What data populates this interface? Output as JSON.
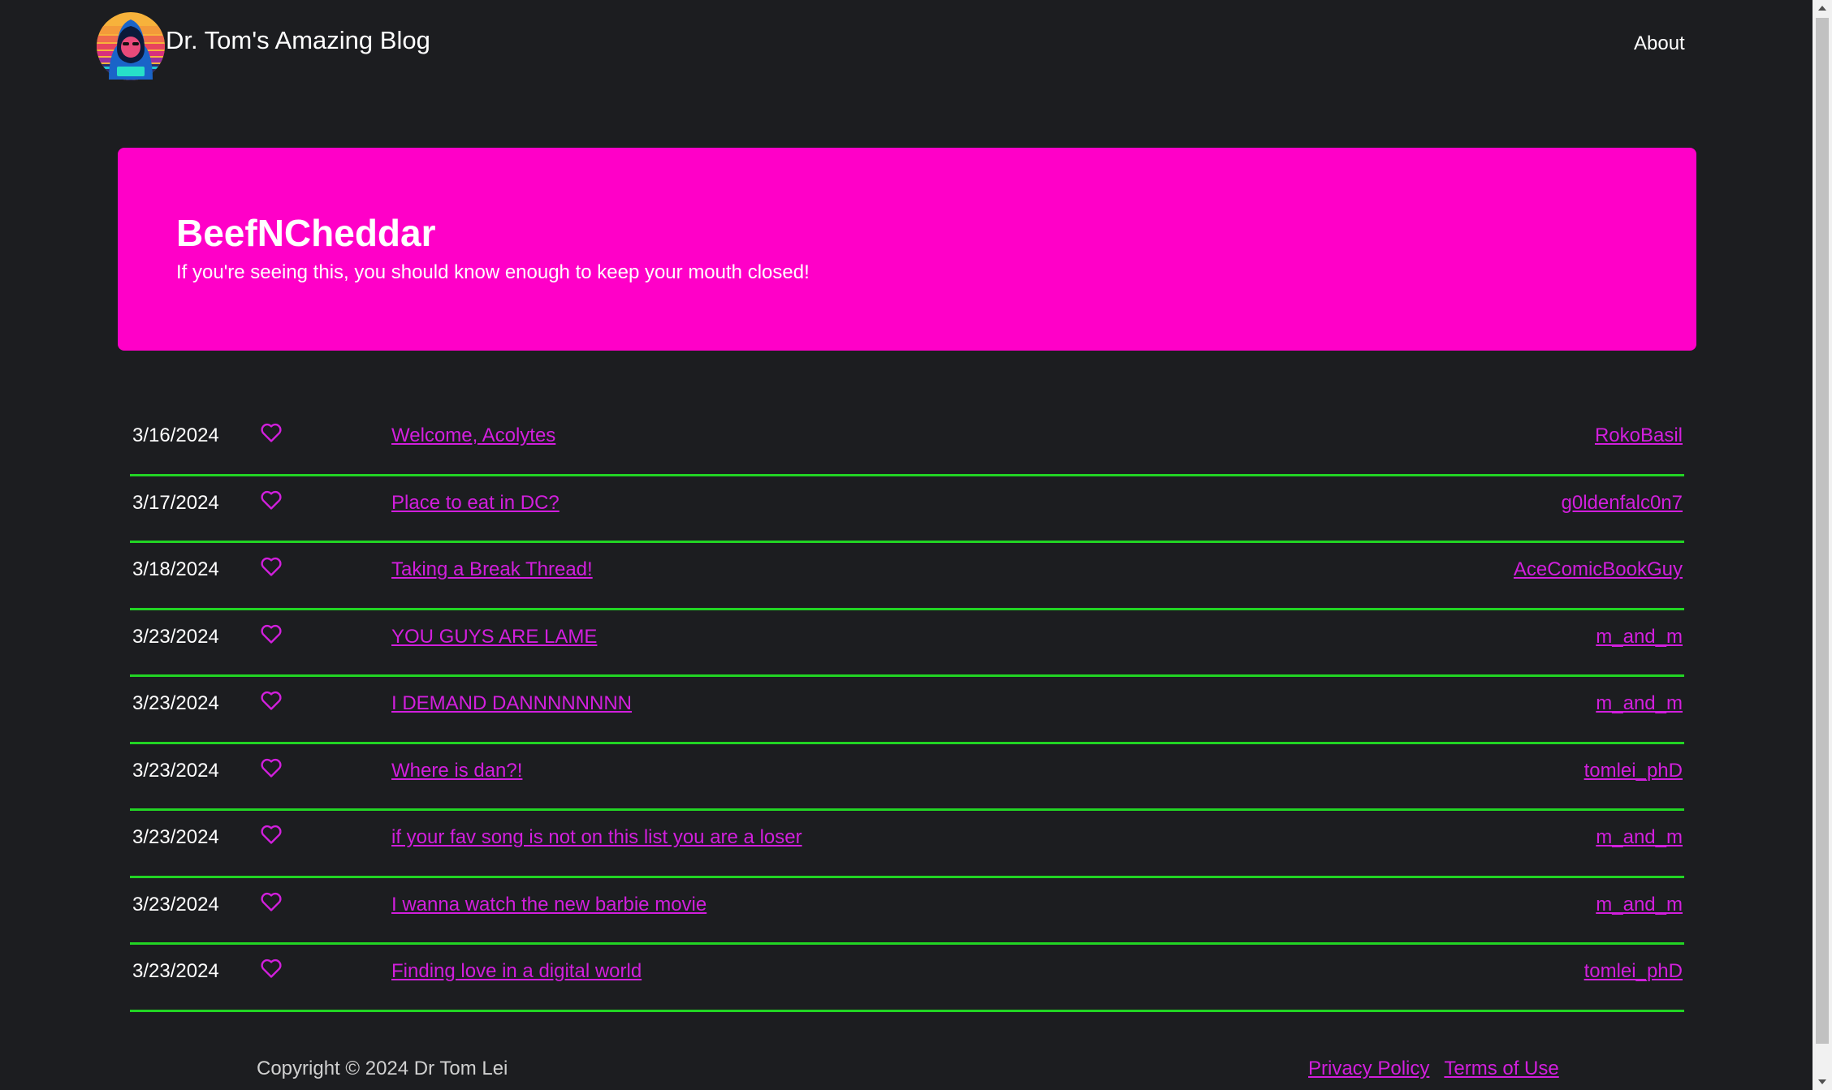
{
  "header": {
    "title": "Dr. Tom's Amazing Blog",
    "nav": {
      "about_label": "About"
    }
  },
  "hero": {
    "title": "BeefNCheddar",
    "subtitle": "If you're seeing this, you should know enough to keep your mouth closed!"
  },
  "posts": [
    {
      "date": "3/16/2024",
      "title": "Welcome, Acolytes",
      "author": "RokoBasil"
    },
    {
      "date": "3/17/2024",
      "title": "Place to eat in DC?",
      "author": "g0ldenfalc0n7"
    },
    {
      "date": "3/18/2024",
      "title": "Taking a Break Thread!",
      "author": "AceComicBookGuy"
    },
    {
      "date": "3/23/2024",
      "title": "YOU GUYS ARE LAME",
      "author": "m_and_m"
    },
    {
      "date": "3/23/2024",
      "title": "I DEMAND DANNNNNNNN",
      "author": "m_and_m"
    },
    {
      "date": "3/23/2024",
      "title": "Where is dan?!",
      "author": "tomlei_phD"
    },
    {
      "date": "3/23/2024",
      "title": "if your fav song is not on this list you are a loser",
      "author": "m_and_m"
    },
    {
      "date": "3/23/2024",
      "title": "I wanna watch the new barbie movie",
      "author": "m_and_m"
    },
    {
      "date": "3/23/2024",
      "title": "Finding love in a digital world",
      "author": "tomlei_phD"
    }
  ],
  "footer": {
    "copyright": "Copyright © 2024 Dr Tom Lei",
    "privacy_label": "Privacy Policy",
    "terms_label": "Terms of Use"
  },
  "icons": {
    "logo": "hooded-hacker-sunset-logo",
    "like": "heart-outline-icon"
  },
  "colors": {
    "background": "#1c1d20",
    "accent": "#ff00c8",
    "link": "#d21fdd",
    "divider": "#22d424"
  }
}
